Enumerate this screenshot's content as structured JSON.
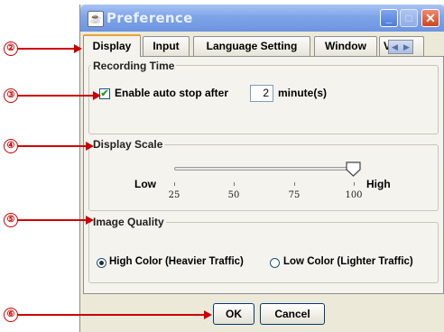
{
  "window": {
    "title": "Preference",
    "app_icon": "java-cup-icon",
    "controls": {
      "minimize": "_",
      "maximize": "□",
      "close": "✕"
    }
  },
  "tabs": [
    {
      "label": "Display",
      "active": true
    },
    {
      "label": "Input"
    },
    {
      "label": "Language Setting"
    },
    {
      "label": "Window"
    },
    {
      "label": "Vi..."
    }
  ],
  "tab_scroll": {
    "left": "◀",
    "right": "▶"
  },
  "recording": {
    "title": "Recording Time",
    "checkbox_label": "Enable auto stop after",
    "checked": true,
    "minutes": "2",
    "unit": "minute(s)"
  },
  "display_scale": {
    "title": "Display Scale",
    "low": "Low",
    "high": "High",
    "ticks": [
      "25",
      "50",
      "75",
      "100"
    ],
    "value": 100
  },
  "image_quality": {
    "title": "Image Quality",
    "options": [
      {
        "label": "High Color (Heavier Traffic)",
        "selected": true
      },
      {
        "label": "Low Color (Lighter Traffic)",
        "selected": false
      }
    ]
  },
  "buttons": {
    "ok": "OK",
    "cancel": "Cancel"
  },
  "callouts": [
    "②",
    "③",
    "④",
    "⑤",
    "⑥"
  ],
  "colors": {
    "callout": "#cc0000",
    "titlebar": "#7ea4e8",
    "tab_accent": "#e6a33c"
  }
}
